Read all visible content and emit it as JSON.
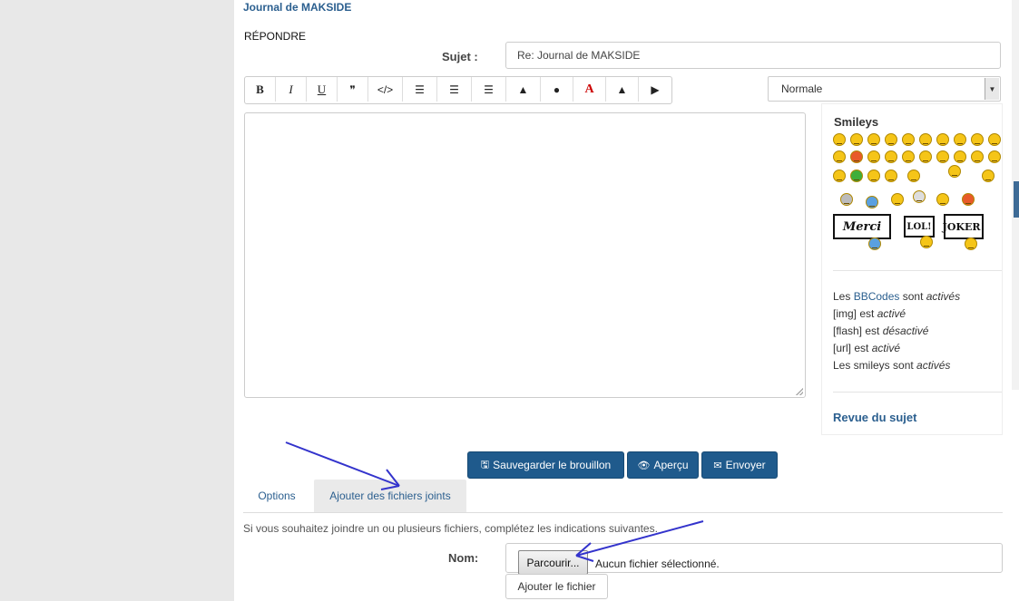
{
  "header": {
    "journal_title": "Journal de MAKSIDE",
    "reply_title": "RÉPONDRE"
  },
  "form": {
    "subject_label": "Sujet :",
    "subject_value": "Re: Journal de MAKSIDE",
    "font_size_select": "Normale"
  },
  "toolbar": {
    "bold": "B",
    "italic": "I",
    "underline": "U",
    "quote": "❞",
    "code": "</>",
    "list1": "☰",
    "list2": "☰",
    "list3": "☰",
    "image": "▲",
    "url": "●",
    "color": "A",
    "warning": "▲",
    "youtube": "▶"
  },
  "sidebar": {
    "smileys_title": "Smileys",
    "signs": {
      "merci": "Merci",
      "lol": "LOL!",
      "joker": "JOKER!"
    },
    "bbcode": {
      "line1_pre": "Les ",
      "line1_link": "BBCodes",
      "line1_mid": " sont ",
      "line1_status": "activés",
      "line2_pre": "[img] est ",
      "line2_status": "activé",
      "line3_pre": "[flash] est ",
      "line3_status": "désactivé",
      "line4_pre": "[url] est ",
      "line4_status": "activé",
      "line5_pre": "Les smileys sont ",
      "line5_status": "activés"
    },
    "revue": "Revue du sujet"
  },
  "actions": {
    "save_draft": "Sauvegarder le brouillon",
    "preview": "Aperçu",
    "send": "Envoyer"
  },
  "tabs": {
    "options": "Options",
    "attachments": "Ajouter des fichiers joints"
  },
  "attachments": {
    "info": "Si vous souhaitez joindre un ou plusieurs fichiers, complétez les indications suivantes.",
    "name_label": "Nom:",
    "browse": "Parcourir...",
    "no_file": "Aucun fichier sélectionné.",
    "add_file": "Ajouter le fichier"
  },
  "colors": {
    "accent": "#2b5f8f",
    "button_blue": "#1f5a8c",
    "annotation_arrow": "#3333cc"
  }
}
